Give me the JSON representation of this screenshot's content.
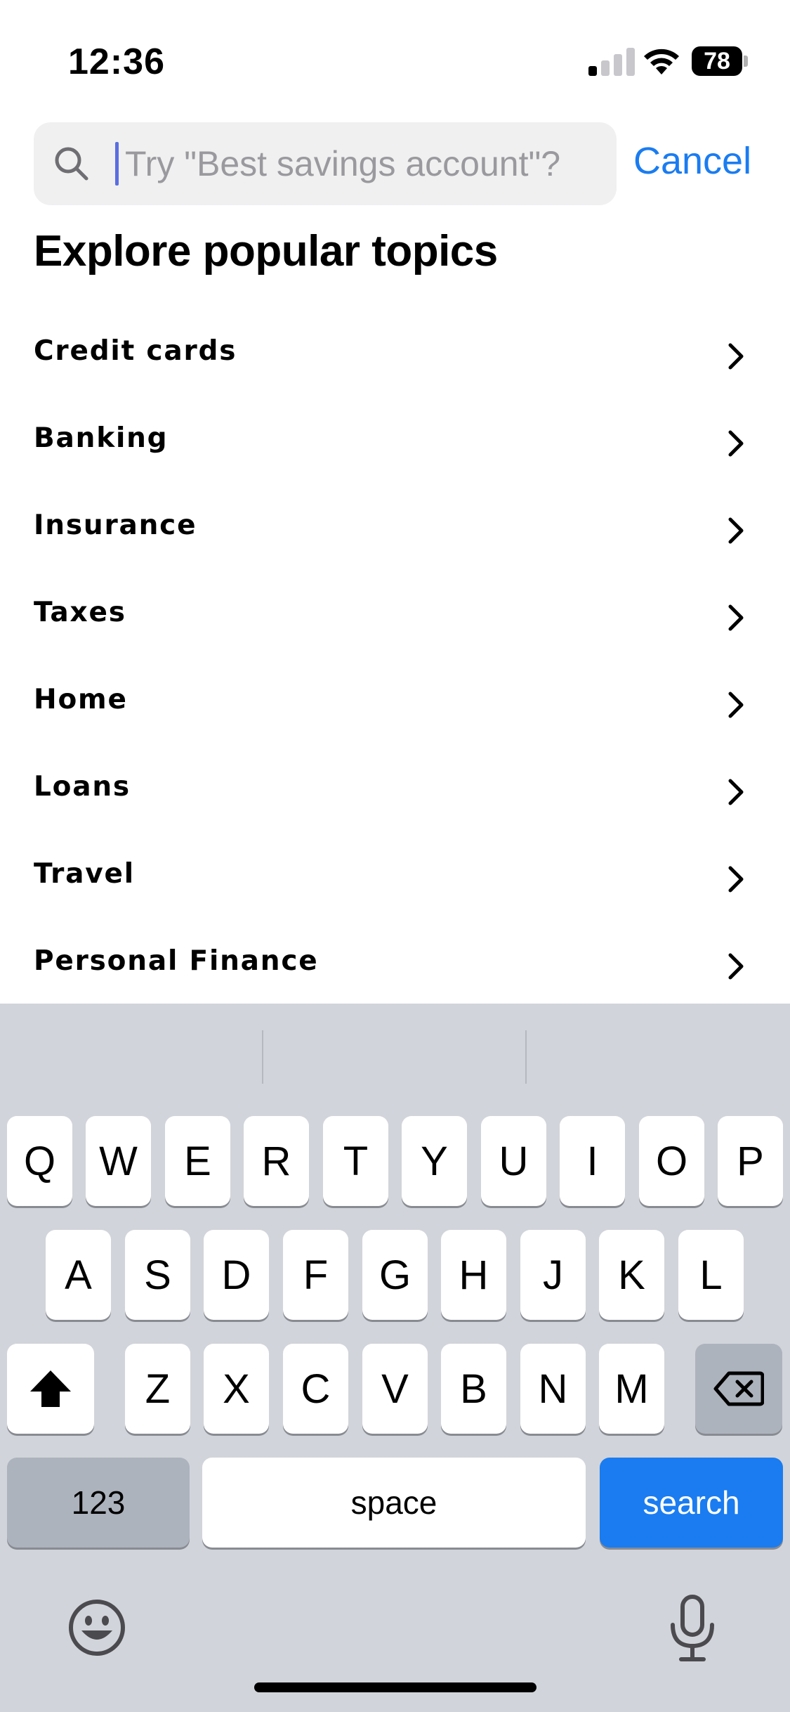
{
  "status_bar": {
    "time": "12:36",
    "battery": "78"
  },
  "search": {
    "placeholder": "Try \"Best savings account\"?",
    "value": "",
    "cancel_label": "Cancel"
  },
  "section_title": "Explore popular topics",
  "topics": [
    {
      "label": "Credit cards"
    },
    {
      "label": "Banking"
    },
    {
      "label": "Insurance"
    },
    {
      "label": "Taxes"
    },
    {
      "label": "Home"
    },
    {
      "label": "Loans"
    },
    {
      "label": "Travel"
    },
    {
      "label": "Personal Finance"
    }
  ],
  "keyboard": {
    "row1": [
      "Q",
      "W",
      "E",
      "R",
      "T",
      "Y",
      "U",
      "I",
      "O",
      "P"
    ],
    "row2": [
      "A",
      "S",
      "D",
      "F",
      "G",
      "H",
      "J",
      "K",
      "L"
    ],
    "row3": [
      "Z",
      "X",
      "C",
      "V",
      "B",
      "N",
      "M"
    ],
    "numbers_label": "123",
    "space_label": "space",
    "search_label": "search",
    "icons": {
      "shift": "shift-icon",
      "delete": "delete-icon",
      "emoji": "emoji-icon",
      "mic": "microphone-icon"
    }
  },
  "colors": {
    "accent": "#1a7cf0",
    "keyboard_bg": "#d1d4da",
    "search_bg": "#f0f0f1"
  }
}
